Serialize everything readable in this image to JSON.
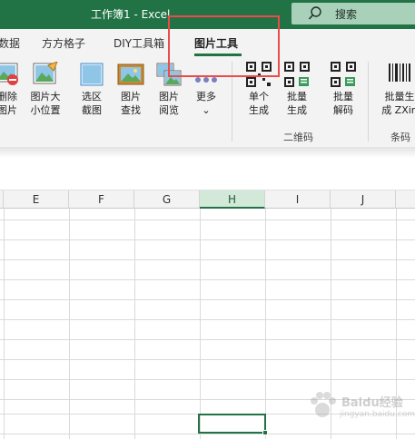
{
  "window": {
    "title": "工作簿1  -  Excel"
  },
  "search": {
    "label": "搜索",
    "icon": "magnifier-icon"
  },
  "tabs": [
    {
      "label": "数据"
    },
    {
      "label": "方方格子"
    },
    {
      "label": "DIY工具箱"
    },
    {
      "label": "图片工具",
      "active": true
    }
  ],
  "ribbon": {
    "buttons": [
      {
        "label1": "删除",
        "label2": "图片"
      },
      {
        "label1": "图片大",
        "label2": "小位置"
      },
      {
        "label1": "选区",
        "label2": "截图"
      },
      {
        "label1": "图片",
        "label2": "查找"
      },
      {
        "label1": "图片",
        "label2": "阅览"
      },
      {
        "label1": "更多",
        "label2": "⌄"
      },
      {
        "label1": "单个",
        "label2": "生成"
      },
      {
        "label1": "批量",
        "label2": "生成"
      },
      {
        "label1": "批量",
        "label2": "解码"
      },
      {
        "label1": "批量生",
        "label2": "成 ZXin"
      }
    ],
    "groups": [
      "二维码",
      "条码"
    ]
  },
  "columns": [
    "E",
    "F",
    "G",
    "H",
    "I",
    "J"
  ],
  "selected_column": "H",
  "watermark": {
    "text": "Baidu经验",
    "url": "jingyan.baidu.com"
  },
  "colors": {
    "accent": "#217346",
    "highlight": "#ea4b4b"
  }
}
